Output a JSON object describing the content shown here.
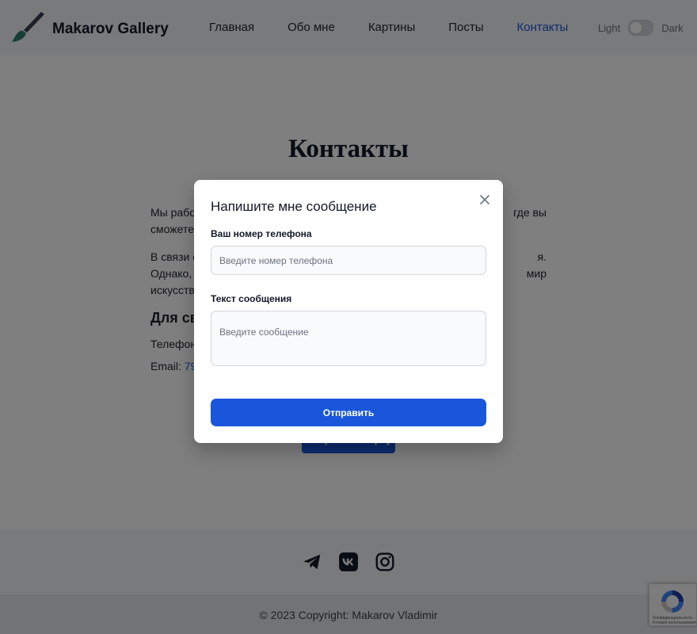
{
  "brand": {
    "name": "Makarov Gallery",
    "logo_icon": "brush-icon"
  },
  "nav": {
    "items": [
      {
        "label": "Главная"
      },
      {
        "label": "Обо мне"
      },
      {
        "label": "Картины"
      },
      {
        "label": "Посты"
      },
      {
        "label": "Контакты"
      }
    ],
    "active": "Контакты"
  },
  "theme_toggle": {
    "light_label": "Light",
    "dark_label": "Dark"
  },
  "page": {
    "title": "Контакты",
    "paragraph1": "Мы рабо                                                                         где вы сможете",
    "paragraph1_left_a": "Мы рабо",
    "paragraph1_right_a": "где вы",
    "paragraph1_left_b": "сможете",
    "paragraph2_left_a": "В связи с",
    "paragraph2_right_a": "я.",
    "paragraph2_left_b": "Однако,",
    "paragraph2_right_b": "мир",
    "paragraph2_left_c": "искусств",
    "heading_visible": "Для св",
    "phone_prefix": "Телефон",
    "email_prefix": "Email:",
    "email_value_visible": "79",
    "send_map_button": "Отправить карту"
  },
  "footer": {
    "social_icons": [
      "telegram-icon",
      "vk-icon",
      "instagram-icon"
    ],
    "copyright": "© 2023 Copyright: Makarov Vladimir"
  },
  "recaptcha": {
    "text": "Конфиденциальность - Условия использования"
  },
  "modal": {
    "title": "Напишите мне сообщение",
    "phone_label": "Ваш номер телефона",
    "phone_placeholder": "Введите номер телефона",
    "phone_value": "",
    "message_label": "Текст сообщения",
    "message_placeholder": "Введите сообщение",
    "message_value": "",
    "submit_label": "Отправить"
  },
  "colors": {
    "accent": "#1a56db",
    "backdrop": "rgba(0,0,0,0.5)",
    "navbar_bg": "#f3f4f6"
  }
}
